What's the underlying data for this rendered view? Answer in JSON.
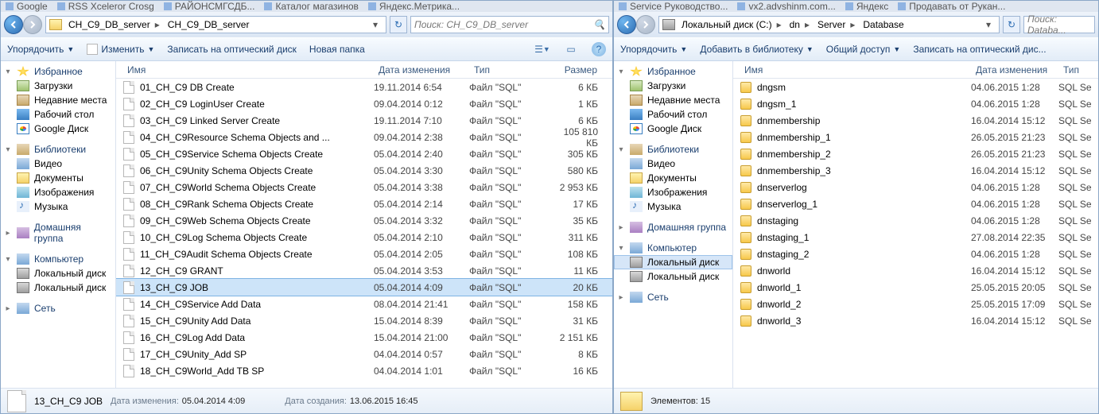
{
  "browser_tabs_left": [
    {
      "label": "Google"
    },
    {
      "label": "RSS Xceleror  Crosg"
    },
    {
      "label": "РАЙОНСМГСДБ..."
    },
    {
      "label": "Каталог магазинов"
    },
    {
      "label": "Яндекс.Метрика..."
    }
  ],
  "browser_tabs_right": [
    {
      "label": "Service Руководство..."
    },
    {
      "label": "vx2.advshinm.com..."
    },
    {
      "label": "Яндекс"
    },
    {
      "label": "Продавать от Рукан..."
    }
  ],
  "left": {
    "breadcrumb": [
      "CH_C9_DB_server",
      "CH_C9_DB_server"
    ],
    "search_placeholder": "Поиск: CH_C9_DB_server",
    "toolbar": {
      "organize": "Упорядочить",
      "edit": "Изменить",
      "burn": "Записать на оптический диск",
      "newfolder": "Новая папка"
    },
    "cols": {
      "name": "Имя",
      "date": "Дата изменения",
      "type": "Тип",
      "size": "Размер"
    },
    "files": [
      {
        "name": "01_CH_C9 DB Create",
        "date": "19.11.2014 6:54",
        "type": "Файл \"SQL\"",
        "size": "6 КБ"
      },
      {
        "name": "02_CH_C9 LoginUser Create",
        "date": "09.04.2014 0:12",
        "type": "Файл \"SQL\"",
        "size": "1 КБ"
      },
      {
        "name": "03_CH_C9 Linked Server Create",
        "date": "19.11.2014 7:10",
        "type": "Файл \"SQL\"",
        "size": "6 КБ"
      },
      {
        "name": "04_CH_C9Resource Schema Objects and ...",
        "date": "09.04.2014 2:38",
        "type": "Файл \"SQL\"",
        "size": "105 810 КБ"
      },
      {
        "name": "05_CH_C9Service Schema Objects Create",
        "date": "05.04.2014 2:40",
        "type": "Файл \"SQL\"",
        "size": "305 КБ"
      },
      {
        "name": "06_CH_C9Unity Schema Objects Create",
        "date": "05.04.2014 3:30",
        "type": "Файл \"SQL\"",
        "size": "580 КБ"
      },
      {
        "name": "07_CH_C9World Schema Objects Create",
        "date": "05.04.2014 3:38",
        "type": "Файл \"SQL\"",
        "size": "2 953 КБ"
      },
      {
        "name": "08_CH_C9Rank Schema Objects Create",
        "date": "05.04.2014 2:14",
        "type": "Файл \"SQL\"",
        "size": "17 КБ"
      },
      {
        "name": "09_CH_C9Web Schema Objects Create",
        "date": "05.04.2014 3:32",
        "type": "Файл \"SQL\"",
        "size": "35 КБ"
      },
      {
        "name": "10_CH_C9Log Schema Objects Create",
        "date": "05.04.2014 2:10",
        "type": "Файл \"SQL\"",
        "size": "311 КБ"
      },
      {
        "name": "11_CH_C9Audit Schema Objects Create",
        "date": "05.04.2014 2:05",
        "type": "Файл \"SQL\"",
        "size": "108 КБ"
      },
      {
        "name": "12_CH_C9 GRANT",
        "date": "05.04.2014 3:53",
        "type": "Файл \"SQL\"",
        "size": "11 КБ"
      },
      {
        "name": "13_CH_C9 JOB",
        "date": "05.04.2014 4:09",
        "type": "Файл \"SQL\"",
        "size": "20 КБ",
        "sel": true
      },
      {
        "name": "14_CH_C9Service Add Data",
        "date": "08.04.2014 21:41",
        "type": "Файл \"SQL\"",
        "size": "158 КБ"
      },
      {
        "name": "15_CH_C9Unity Add Data",
        "date": "15.04.2014 8:39",
        "type": "Файл \"SQL\"",
        "size": "31 КБ"
      },
      {
        "name": "16_CH_C9Log Add Data",
        "date": "15.04.2014 21:00",
        "type": "Файл \"SQL\"",
        "size": "2 151 КБ"
      },
      {
        "name": "17_CH_C9Unity_Add SP",
        "date": "04.04.2014 0:57",
        "type": "Файл \"SQL\"",
        "size": "8 КБ"
      },
      {
        "name": "18_CH_C9World_Add TB SP",
        "date": "04.04.2014 1:01",
        "type": "Файл \"SQL\"",
        "size": "16 КБ"
      }
    ],
    "status": {
      "name": "13_CH_C9 JOB",
      "modlabel": "Дата изменения:",
      "modval": "05.04.2014 4:09",
      "createdlabel": "Дата создания:",
      "createdval": "13.06.2015 16:45"
    }
  },
  "right": {
    "breadcrumb": [
      "Локальный диск (C:)",
      "dn",
      "Server",
      "Database"
    ],
    "search_placeholder": "Поиск: Databa...",
    "toolbar": {
      "organize": "Упорядочить",
      "addlib": "Добавить в библиотеку",
      "share": "Общий доступ",
      "burn": "Записать на оптический дис..."
    },
    "cols": {
      "name": "Имя",
      "date": "Дата изменения",
      "type": "Тип"
    },
    "files": [
      {
        "name": "dngsm",
        "date": "04.06.2015 1:28",
        "type": "SQL Se"
      },
      {
        "name": "dngsm_1",
        "date": "04.06.2015 1:28",
        "type": "SQL Se"
      },
      {
        "name": "dnmembership",
        "date": "16.04.2014 15:12",
        "type": "SQL Se"
      },
      {
        "name": "dnmembership_1",
        "date": "26.05.2015 21:23",
        "type": "SQL Se"
      },
      {
        "name": "dnmembership_2",
        "date": "26.05.2015 21:23",
        "type": "SQL Se"
      },
      {
        "name": "dnmembership_3",
        "date": "16.04.2014 15:12",
        "type": "SQL Se"
      },
      {
        "name": "dnserverlog",
        "date": "04.06.2015 1:28",
        "type": "SQL Se"
      },
      {
        "name": "dnserverlog_1",
        "date": "04.06.2015 1:28",
        "type": "SQL Se"
      },
      {
        "name": "dnstaging",
        "date": "04.06.2015 1:28",
        "type": "SQL Se"
      },
      {
        "name": "dnstaging_1",
        "date": "27.08.2014 22:35",
        "type": "SQL Se"
      },
      {
        "name": "dnstaging_2",
        "date": "04.06.2015 1:28",
        "type": "SQL Se"
      },
      {
        "name": "dnworld",
        "date": "16.04.2014 15:12",
        "type": "SQL Se"
      },
      {
        "name": "dnworld_1",
        "date": "25.05.2015 20:05",
        "type": "SQL Se"
      },
      {
        "name": "dnworld_2",
        "date": "25.05.2015 17:09",
        "type": "SQL Se"
      },
      {
        "name": "dnworld_3",
        "date": "16.04.2014 15:12",
        "type": "SQL Se"
      }
    ],
    "status": {
      "countlabel": "Элементов: 15"
    }
  },
  "nav": {
    "fav": "Избранное",
    "dl": "Загрузки",
    "recent": "Недавние места",
    "desk": "Рабочий стол",
    "gd": "Google Диск",
    "lib": "Библиотеки",
    "vid": "Видео",
    "doc": "Документы",
    "img": "Изображения",
    "mus": "Музыка",
    "home": "Домашняя группа",
    "comp": "Компьютер",
    "hdd": "Локальный диск",
    "net": "Сеть"
  }
}
